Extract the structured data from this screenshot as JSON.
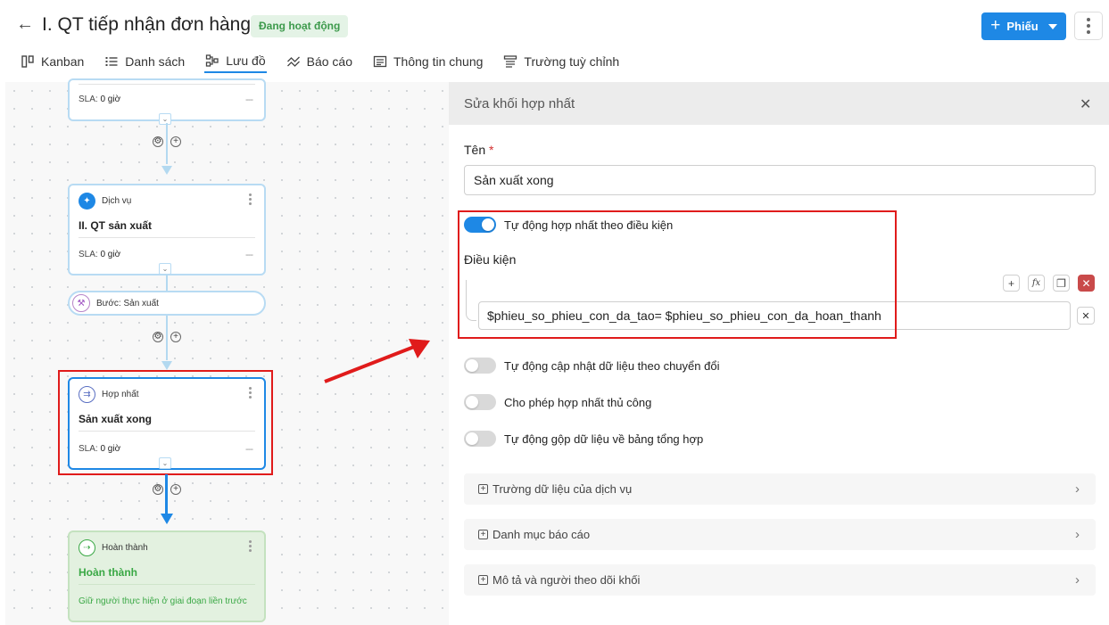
{
  "header": {
    "back_icon": "arrow-left-icon",
    "title": "I. QT tiếp nhận đơn hàng",
    "status_badge": "Đang hoạt động",
    "primary_button": "Phiếu",
    "more_icon": "vertical-dots-icon"
  },
  "tabs": [
    {
      "label": "Kanban",
      "icon": "kanban-icon",
      "active": false
    },
    {
      "label": "Danh sách",
      "icon": "list-icon",
      "active": false
    },
    {
      "label": "Lưu đồ",
      "icon": "flowchart-icon",
      "active": true
    },
    {
      "label": "Báo cáo",
      "icon": "chart-line-icon",
      "active": false
    },
    {
      "label": "Thông tin chung",
      "icon": "info-card-icon",
      "active": false
    },
    {
      "label": "Trường tuỳ chỉnh",
      "icon": "custom-fields-icon",
      "active": false
    }
  ],
  "flow": {
    "top_node": {
      "sla_label": "SLA:",
      "sla_value": "0 giờ",
      "sla_dash": "---"
    },
    "service_node": {
      "type": "Dịch vụ",
      "title": "II. QT sản xuất",
      "sla_label": "SLA:",
      "sla_value": "0 giờ",
      "sla_dash": "---"
    },
    "step_pill": {
      "label": "Bước: Sản xuất"
    },
    "merge_node": {
      "type": "Hợp nhất",
      "title": "Sản xuất xong",
      "sla_label": "SLA:",
      "sla_value": "0 giờ",
      "sla_dash": "---"
    },
    "done_node": {
      "type": "Hoàn thành",
      "title": "Hoàn thành",
      "note": "Giữ người thực hiện ở giai đoạn liền trước"
    }
  },
  "panel": {
    "title": "Sửa khối hợp nhất",
    "name_label": "Tên",
    "name_required_mark": "*",
    "name_value": "Sản xuất xong",
    "toggles": [
      {
        "label": "Tự động hợp nhất theo điều kiện",
        "on": true
      },
      {
        "label": "Tự động cập nhật dữ liệu theo chuyển đổi",
        "on": false
      },
      {
        "label": "Cho phép hợp nhất thủ công",
        "on": false
      },
      {
        "label": "Tự động gộp dữ liệu về bảng tổng hợp",
        "on": false
      }
    ],
    "condition_label": "Điều kiện",
    "condition_value": "$phieu_so_phieu_con_da_tao= $phieu_so_phieu_con_da_hoan_thanh",
    "fx_label": "fx",
    "sections": [
      {
        "label": "Trường dữ liệu của dịch vụ"
      },
      {
        "label": "Danh mục báo cáo"
      },
      {
        "label": "Mô tả và người theo dõi khối"
      }
    ]
  },
  "colors": {
    "primary": "#1e88e5",
    "badge_bg": "#e4f3e6",
    "badge_text": "#3d9a4c",
    "highlight": "#e01b1b",
    "done_green": "#3aa845"
  }
}
